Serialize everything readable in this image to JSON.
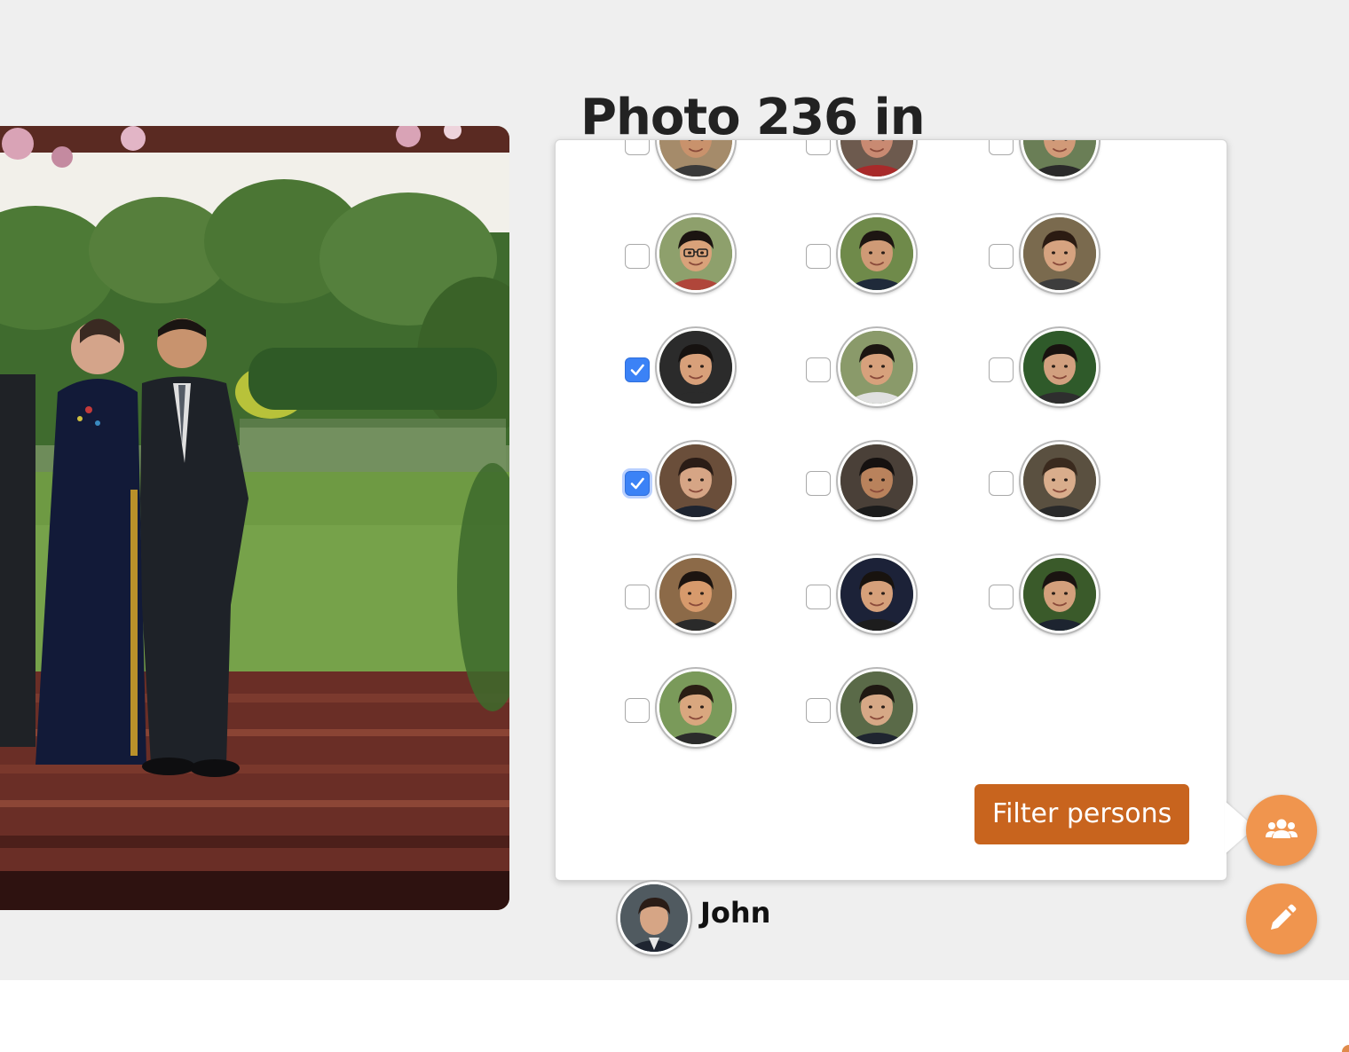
{
  "page": {
    "title": "Photo 236 in"
  },
  "photo": {
    "icon": "photo"
  },
  "filter": {
    "tooltip": "Filter persons",
    "persons": [
      {
        "checked": false,
        "skin": "#c9926c",
        "hair": "#1f1712",
        "bg": "#a58b6a",
        "shirt": "#3a3a3a",
        "partial": true
      },
      {
        "checked": false,
        "skin": "#c98a72",
        "hair": "#2a1c18",
        "bg": "#6d5a4e",
        "shirt": "#a82a2a",
        "partial": true
      },
      {
        "checked": false,
        "skin": "#d19a78",
        "hair": "#231a14",
        "bg": "#6a7e56",
        "shirt": "#2a2a2a",
        "partial": true
      },
      {
        "checked": false,
        "skin": "#d9a27a",
        "hair": "#1b1411",
        "bg": "#8ea06c",
        "shirt": "#b0463a",
        "glasses": true
      },
      {
        "checked": false,
        "skin": "#cf9a76",
        "hair": "#1d1612",
        "bg": "#6f8a4a",
        "shirt": "#1f2a3a"
      },
      {
        "checked": false,
        "skin": "#d6a380",
        "hair": "#2b1b12",
        "bg": "#7a6a4e",
        "shirt": "#3d3d3d"
      },
      {
        "checked": true,
        "skin": "#d8a07a",
        "hair": "#161210",
        "bg": "#2b2b2b",
        "shirt": "#2b2b2b"
      },
      {
        "checked": false,
        "skin": "#d7a17c",
        "hair": "#1b1511",
        "bg": "#8a9a6a",
        "shirt": "#e0e0e0"
      },
      {
        "checked": false,
        "skin": "#d2a07f",
        "hair": "#18120f",
        "bg": "#2f5a2a",
        "shirt": "#2e2e2e"
      },
      {
        "checked": true,
        "focus": true,
        "skin": "#d6a585",
        "hair": "#2a1c16",
        "bg": "#6a4e3a",
        "shirt": "#1e2430"
      },
      {
        "checked": false,
        "skin": "#b9825c",
        "hair": "#151110",
        "bg": "#4a4038",
        "shirt": "#1c1c1c"
      },
      {
        "checked": false,
        "skin": "#d9ad8c",
        "hair": "#3a2a1e",
        "bg": "#5a5040",
        "shirt": "#2a2a2a"
      },
      {
        "checked": false,
        "skin": "#d79a6c",
        "hair": "#1c1410",
        "bg": "#8c6a48",
        "shirt": "#2a2a2a"
      },
      {
        "checked": false,
        "skin": "#d6a07a",
        "hair": "#18130f",
        "bg": "#1c2238",
        "shirt": "#1d1d1d"
      },
      {
        "checked": false,
        "skin": "#d3a07c",
        "hair": "#1a1411",
        "bg": "#3a5a2a",
        "shirt": "#1d2430"
      },
      {
        "checked": false,
        "skin": "#d9a77f",
        "hair": "#2a1e14",
        "bg": "#7a9a5a",
        "shirt": "#2b2b2b"
      },
      {
        "checked": false,
        "skin": "#d6a886",
        "hair": "#1f1812",
        "bg": "#5a6a48",
        "shirt": "#1f2530"
      }
    ]
  },
  "tag": {
    "name": "John"
  },
  "actions": {
    "persons_icon": "users-icon",
    "edit_icon": "pencil-icon"
  },
  "colors": {
    "accent": "#f0954e",
    "tooltip": "#c8641e",
    "checkbox_checked": "#3b82f6"
  }
}
